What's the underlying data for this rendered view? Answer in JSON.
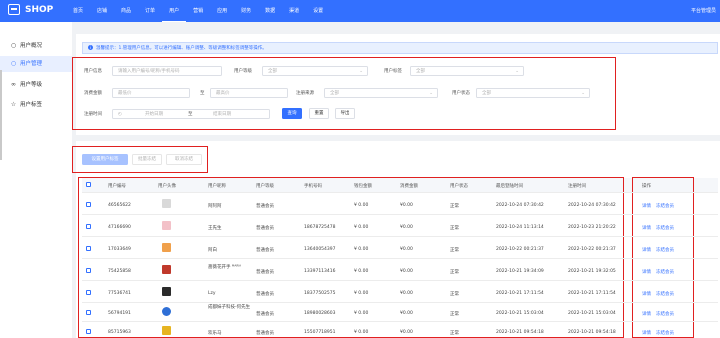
{
  "topbar": {
    "logo": "SHOP",
    "nav": [
      "首页",
      "店铺",
      "商品",
      "订单",
      "用户",
      "营销",
      "应用",
      "财务",
      "数据",
      "渠道",
      "设置"
    ],
    "active_index": 4,
    "admin": "平台管理员"
  },
  "sidebar": {
    "items": [
      {
        "label": "用户概况",
        "icon": "person-icon"
      },
      {
        "label": "用户管理",
        "icon": "user-manage-icon"
      },
      {
        "label": "用户等级",
        "icon": "level-icon"
      },
      {
        "label": "用户标签",
        "icon": "tag-icon"
      }
    ],
    "active_index": 1
  },
  "notice": "温馨提示：1.管理用户信息，可以进行编辑、账户调整、等级调整和标签调整等操作。",
  "filters": {
    "keyword_label": "用户信息",
    "keyword_placeholder": "请输入用户编号/昵称/手机号码",
    "level_label": "用户等级",
    "level_value": "全部",
    "tag_label": "用户标签",
    "tag_value": "全部",
    "spend_label": "消费金额",
    "spend_min_placeholder": "最低价",
    "spend_to": "至",
    "spend_max_placeholder": "最高价",
    "source_label": "注册来源",
    "source_value": "全部",
    "status_label": "用户状态",
    "status_value": "全部",
    "regtime_label": "注册时间",
    "start_placeholder": "开始日期",
    "date_to": "至",
    "end_placeholder": "结束日期",
    "query": "查询",
    "reset": "重置",
    "export": "导出"
  },
  "actions": {
    "set_member": "设置用户标签",
    "batch_freeze": "批量冻结",
    "cancel_freeze": "取消冻结"
  },
  "table": {
    "columns": [
      "用户编号",
      "用户头像",
      "用户昵称",
      "用户等级",
      "手机号码",
      "钱包金额",
      "消费金额",
      "用户状态",
      "最后登陆时间",
      "注册时间"
    ],
    "op_column": "操作",
    "rows": [
      {
        "id": "46565622",
        "avatar": "gray",
        "nickname": "阿阿阿",
        "level": "普通会员",
        "phone": "",
        "wallet": "¥ 0.00",
        "spend": "¥0.00",
        "status": "正常",
        "last_login": "2022-10-24 07:30:42",
        "registered": "2022-10-24 07:30:42"
      },
      {
        "id": "47166690",
        "avatar": "pink",
        "nickname": "王先生",
        "level": "普通会员",
        "phone": "18678725478",
        "wallet": "¥ 0.00",
        "spend": "¥0.00",
        "status": "正常",
        "last_login": "2022-10-24 11:13:14",
        "registered": "2022-10-23 21:20:22"
      },
      {
        "id": "17033649",
        "avatar": "orange",
        "nickname": "阿白",
        "level": "普通会员",
        "phone": "13640054397",
        "wallet": "¥ 0.00",
        "spend": "¥0.00",
        "status": "正常",
        "last_login": "2022-10-22 00:21:37",
        "registered": "2022-10-22 00:21:37"
      },
      {
        "id": "75425858",
        "avatar": "red",
        "nickname": "蔷薇花开手 ᴹᴬᴿᴵᴬ",
        "level": "普通会员",
        "phone": "13397113416",
        "wallet": "¥ 0.00",
        "spend": "¥0.00",
        "status": "正常",
        "last_login": "2022-10-21 19:34:09",
        "registered": "2022-10-21 19:32:05"
      },
      {
        "id": "77536741",
        "avatar": "dark",
        "nickname": "Lzy",
        "level": "普通会员",
        "phone": "18377502575",
        "wallet": "¥ 0.00",
        "spend": "¥0.00",
        "status": "正常",
        "last_login": "2022-10-21 17:11:54",
        "registered": "2022-10-21 17:11:54"
      },
      {
        "id": "56794191",
        "avatar": "blue",
        "nickname": "成都妹子科技-何先生",
        "level": "普通会员",
        "phone": "18980028603",
        "wallet": "¥ 0.00",
        "spend": "¥0.00",
        "status": "正常",
        "last_login": "2022-10-21 15:03:04",
        "registered": "2022-10-21 15:03:04"
      },
      {
        "id": "85715963",
        "avatar": "yellow",
        "nickname": "欢乐马",
        "level": "普通会员",
        "phone": "15507718951",
        "wallet": "¥ 0.00",
        "spend": "¥0.00",
        "status": "正常",
        "last_login": "2022-10-21 09:54:18",
        "registered": "2022-10-21 09:54:18"
      }
    ],
    "op_detail": "详情",
    "op_freeze": "冻结会员"
  },
  "colors": {
    "primary": "#3370ff",
    "highlight": "#e02020",
    "disabled_button": "#a7c2ff"
  }
}
